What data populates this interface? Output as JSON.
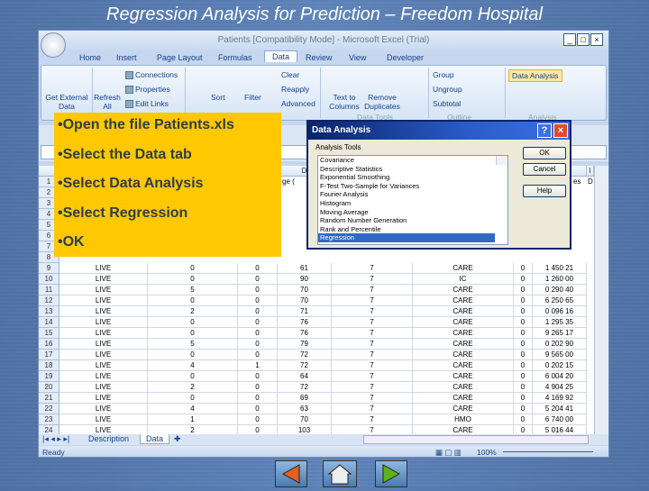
{
  "slide": {
    "title": "Regression Analysis for Prediction – Freedom Hospital",
    "bullets": [
      "•Open the file Patients.xls",
      "•Select the Data tab",
      "•Select Data Analysis",
      "•Select Regression",
      "•OK"
    ]
  },
  "excel": {
    "window_title": "Patients  [Compatibility Mode] - Microsoft Excel (Trial)",
    "tabs": [
      "Home",
      "Insert",
      "Page Layout",
      "Formulas",
      "Data",
      "Review",
      "View",
      "Developer"
    ],
    "active_tab": "Data",
    "ribbon": {
      "get_external": "Get External Data",
      "refresh": "Refresh All",
      "connections": "Connections",
      "properties": "Properties",
      "edit_links": "Edit Links",
      "sort": "Sort",
      "filter": "Filter",
      "clear": "Clear",
      "reapply": "Reapply",
      "advanced": "Advanced",
      "text_to_columns": "Text to Columns",
      "remove_duplicates": "Remove Duplicates",
      "data_tools": "Data Tools",
      "group": "Group",
      "ungroup": "Ungroup",
      "subtotal": "Subtotal",
      "outline": "Outline",
      "data_analysis": "Data Analysis",
      "analysis": "Analysis"
    },
    "columns": [
      "A",
      "B",
      "C",
      "D",
      "E",
      "F",
      "G",
      "H",
      "I"
    ],
    "header_partial": [
      "ge (",
      "es",
      "D"
    ],
    "rows": [
      [
        "9",
        "LIVE",
        "0",
        "0",
        "61",
        "7",
        "CARE",
        "0",
        "1 450 21"
      ],
      [
        "10",
        "LIVE",
        "0",
        "0",
        "90",
        "7",
        "IC",
        "0",
        "1 260 00"
      ],
      [
        "11",
        "LIVE",
        "5",
        "0",
        "70",
        "7",
        "CARE",
        "0",
        "0 290 40"
      ],
      [
        "12",
        "LIVE",
        "0",
        "0",
        "70",
        "7",
        "CARE",
        "0",
        "6 250 65"
      ],
      [
        "13",
        "LIVE",
        "2",
        "0",
        "71",
        "7",
        "CARE",
        "0",
        "0 096 16"
      ],
      [
        "14",
        "LIVE",
        "0",
        "0",
        "76",
        "7",
        "CARE",
        "0",
        "1 295 35"
      ],
      [
        "15",
        "LIVE",
        "0",
        "0",
        "76",
        "7",
        "CARE",
        "0",
        "9 265 17"
      ],
      [
        "16",
        "LIVE",
        "5",
        "0",
        "79",
        "7",
        "CARE",
        "0",
        "0 202 90"
      ],
      [
        "17",
        "LIVE",
        "0",
        "0",
        "72",
        "7",
        "CARE",
        "0",
        "9 565 00"
      ],
      [
        "18",
        "LIVE",
        "4",
        "1",
        "72",
        "7",
        "CARE",
        "0",
        "0 202 15"
      ],
      [
        "19",
        "LIVE",
        "0",
        "0",
        "64",
        "7",
        "CARE",
        "0",
        "6 004 20"
      ],
      [
        "20",
        "LIVE",
        "2",
        "0",
        "72",
        "7",
        "CARE",
        "0",
        "4 904 25"
      ],
      [
        "21",
        "LIVE",
        "0",
        "0",
        "69",
        "7",
        "CARE",
        "0",
        "4 169 92"
      ],
      [
        "22",
        "LIVE",
        "4",
        "0",
        "63",
        "7",
        "CARE",
        "0",
        "5 204 41"
      ],
      [
        "23",
        "LIVE",
        "1",
        "0",
        "70",
        "7",
        "HMO",
        "0",
        "6 740 00"
      ],
      [
        "24",
        "LIVE",
        "2",
        "0",
        "103",
        "7",
        "CARE",
        "0",
        "5 016 44"
      ]
    ],
    "sheet_tabs": [
      "Description",
      "Data"
    ],
    "active_sheet": "Data",
    "status": "Ready",
    "zoom": "100%"
  },
  "dialog": {
    "title": "Data Analysis",
    "label": "Analysis Tools",
    "items": [
      "Covariance",
      "Descriptive Statistics",
      "Exponential Smoothing",
      "F-Test Two-Sample for Variances",
      "Fourier Analysis",
      "Histogram",
      "Moving Average",
      "Random Number Generation",
      "Rank and Percentile",
      "Regression"
    ],
    "selected": "Regression",
    "ok": "OK",
    "cancel": "Cancel",
    "help": "Help"
  },
  "colors": {
    "note": "#ffc800",
    "selection": "#316ac5"
  }
}
